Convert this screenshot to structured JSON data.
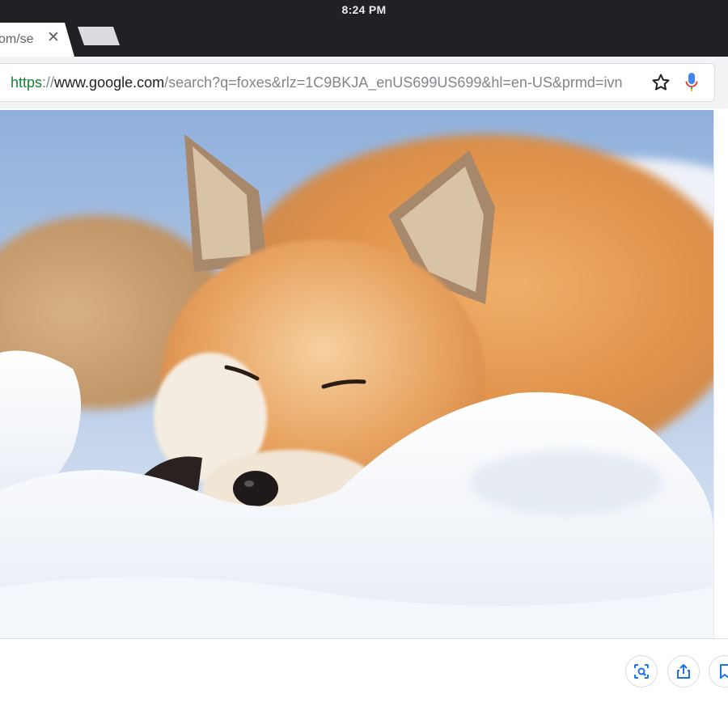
{
  "status_bar": {
    "time": "8:24 PM"
  },
  "tabs": [
    {
      "title": "om/se",
      "active": true
    }
  ],
  "omnibox": {
    "scheme": "https",
    "separator": "://",
    "host": "www.google.com",
    "path": "/search?q=foxes&rlz=1C9BKJA_enUS699US699&hl=en-US&prmd=ivn"
  },
  "icons": {
    "tab_close": "close-icon",
    "bookmark": "star-icon",
    "voice": "microphone-icon",
    "lens": "lens-icon",
    "share": "share-icon",
    "save": "bookmark-icon"
  },
  "image": {
    "subject": "photo",
    "alt": ""
  },
  "colors": {
    "chrome_dark": "#202124",
    "url_scheme": "#188038",
    "mic_blue": "#4285f4",
    "action_blue": "#1a73e8"
  }
}
